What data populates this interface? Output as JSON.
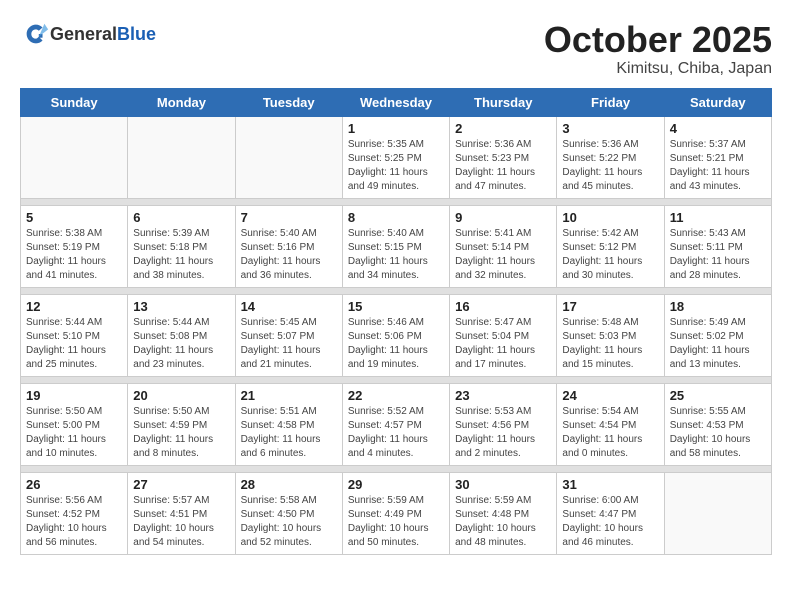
{
  "header": {
    "logo_general": "General",
    "logo_blue": "Blue",
    "month": "October 2025",
    "location": "Kimitsu, Chiba, Japan"
  },
  "weekdays": [
    "Sunday",
    "Monday",
    "Tuesday",
    "Wednesday",
    "Thursday",
    "Friday",
    "Saturday"
  ],
  "weeks": [
    [
      {
        "day": "",
        "info": ""
      },
      {
        "day": "",
        "info": ""
      },
      {
        "day": "",
        "info": ""
      },
      {
        "day": "1",
        "info": "Sunrise: 5:35 AM\nSunset: 5:25 PM\nDaylight: 11 hours\nand 49 minutes."
      },
      {
        "day": "2",
        "info": "Sunrise: 5:36 AM\nSunset: 5:23 PM\nDaylight: 11 hours\nand 47 minutes."
      },
      {
        "day": "3",
        "info": "Sunrise: 5:36 AM\nSunset: 5:22 PM\nDaylight: 11 hours\nand 45 minutes."
      },
      {
        "day": "4",
        "info": "Sunrise: 5:37 AM\nSunset: 5:21 PM\nDaylight: 11 hours\nand 43 minutes."
      }
    ],
    [
      {
        "day": "5",
        "info": "Sunrise: 5:38 AM\nSunset: 5:19 PM\nDaylight: 11 hours\nand 41 minutes."
      },
      {
        "day": "6",
        "info": "Sunrise: 5:39 AM\nSunset: 5:18 PM\nDaylight: 11 hours\nand 38 minutes."
      },
      {
        "day": "7",
        "info": "Sunrise: 5:40 AM\nSunset: 5:16 PM\nDaylight: 11 hours\nand 36 minutes."
      },
      {
        "day": "8",
        "info": "Sunrise: 5:40 AM\nSunset: 5:15 PM\nDaylight: 11 hours\nand 34 minutes."
      },
      {
        "day": "9",
        "info": "Sunrise: 5:41 AM\nSunset: 5:14 PM\nDaylight: 11 hours\nand 32 minutes."
      },
      {
        "day": "10",
        "info": "Sunrise: 5:42 AM\nSunset: 5:12 PM\nDaylight: 11 hours\nand 30 minutes."
      },
      {
        "day": "11",
        "info": "Sunrise: 5:43 AM\nSunset: 5:11 PM\nDaylight: 11 hours\nand 28 minutes."
      }
    ],
    [
      {
        "day": "12",
        "info": "Sunrise: 5:44 AM\nSunset: 5:10 PM\nDaylight: 11 hours\nand 25 minutes."
      },
      {
        "day": "13",
        "info": "Sunrise: 5:44 AM\nSunset: 5:08 PM\nDaylight: 11 hours\nand 23 minutes."
      },
      {
        "day": "14",
        "info": "Sunrise: 5:45 AM\nSunset: 5:07 PM\nDaylight: 11 hours\nand 21 minutes."
      },
      {
        "day": "15",
        "info": "Sunrise: 5:46 AM\nSunset: 5:06 PM\nDaylight: 11 hours\nand 19 minutes."
      },
      {
        "day": "16",
        "info": "Sunrise: 5:47 AM\nSunset: 5:04 PM\nDaylight: 11 hours\nand 17 minutes."
      },
      {
        "day": "17",
        "info": "Sunrise: 5:48 AM\nSunset: 5:03 PM\nDaylight: 11 hours\nand 15 minutes."
      },
      {
        "day": "18",
        "info": "Sunrise: 5:49 AM\nSunset: 5:02 PM\nDaylight: 11 hours\nand 13 minutes."
      }
    ],
    [
      {
        "day": "19",
        "info": "Sunrise: 5:50 AM\nSunset: 5:00 PM\nDaylight: 11 hours\nand 10 minutes."
      },
      {
        "day": "20",
        "info": "Sunrise: 5:50 AM\nSunset: 4:59 PM\nDaylight: 11 hours\nand 8 minutes."
      },
      {
        "day": "21",
        "info": "Sunrise: 5:51 AM\nSunset: 4:58 PM\nDaylight: 11 hours\nand 6 minutes."
      },
      {
        "day": "22",
        "info": "Sunrise: 5:52 AM\nSunset: 4:57 PM\nDaylight: 11 hours\nand 4 minutes."
      },
      {
        "day": "23",
        "info": "Sunrise: 5:53 AM\nSunset: 4:56 PM\nDaylight: 11 hours\nand 2 minutes."
      },
      {
        "day": "24",
        "info": "Sunrise: 5:54 AM\nSunset: 4:54 PM\nDaylight: 11 hours\nand 0 minutes."
      },
      {
        "day": "25",
        "info": "Sunrise: 5:55 AM\nSunset: 4:53 PM\nDaylight: 10 hours\nand 58 minutes."
      }
    ],
    [
      {
        "day": "26",
        "info": "Sunrise: 5:56 AM\nSunset: 4:52 PM\nDaylight: 10 hours\nand 56 minutes."
      },
      {
        "day": "27",
        "info": "Sunrise: 5:57 AM\nSunset: 4:51 PM\nDaylight: 10 hours\nand 54 minutes."
      },
      {
        "day": "28",
        "info": "Sunrise: 5:58 AM\nSunset: 4:50 PM\nDaylight: 10 hours\nand 52 minutes."
      },
      {
        "day": "29",
        "info": "Sunrise: 5:59 AM\nSunset: 4:49 PM\nDaylight: 10 hours\nand 50 minutes."
      },
      {
        "day": "30",
        "info": "Sunrise: 5:59 AM\nSunset: 4:48 PM\nDaylight: 10 hours\nand 48 minutes."
      },
      {
        "day": "31",
        "info": "Sunrise: 6:00 AM\nSunset: 4:47 PM\nDaylight: 10 hours\nand 46 minutes."
      },
      {
        "day": "",
        "info": ""
      }
    ]
  ]
}
